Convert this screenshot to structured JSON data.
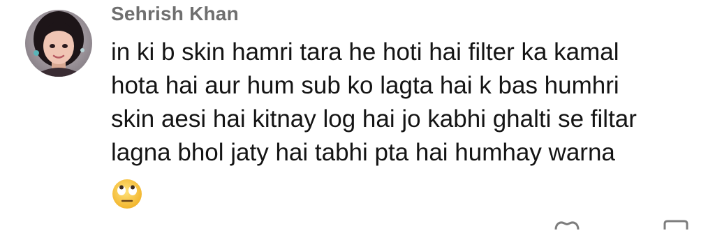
{
  "comment": {
    "author": "Sehrish Khan",
    "text_lines": [
      "in ki b skin hamri tara he hoti hai filter ka kamal",
      "hota hai aur hum sub ko lagta hai k bas humhri",
      "skin aesi hai kitnay log hai jo kabhi ghalti se filtar",
      "lagna bhol jaty hai tabhi pta hai humhay warna"
    ],
    "emoji_icon": "face-with-rolling-eyes-emoji",
    "actions": {
      "like_icon": "heart-icon",
      "reply_icon": "reply-icon"
    }
  },
  "colors": {
    "author": "#6f6f6f",
    "text": "#141414",
    "background": "#ffffff",
    "emoji_face": "#f7c742"
  }
}
